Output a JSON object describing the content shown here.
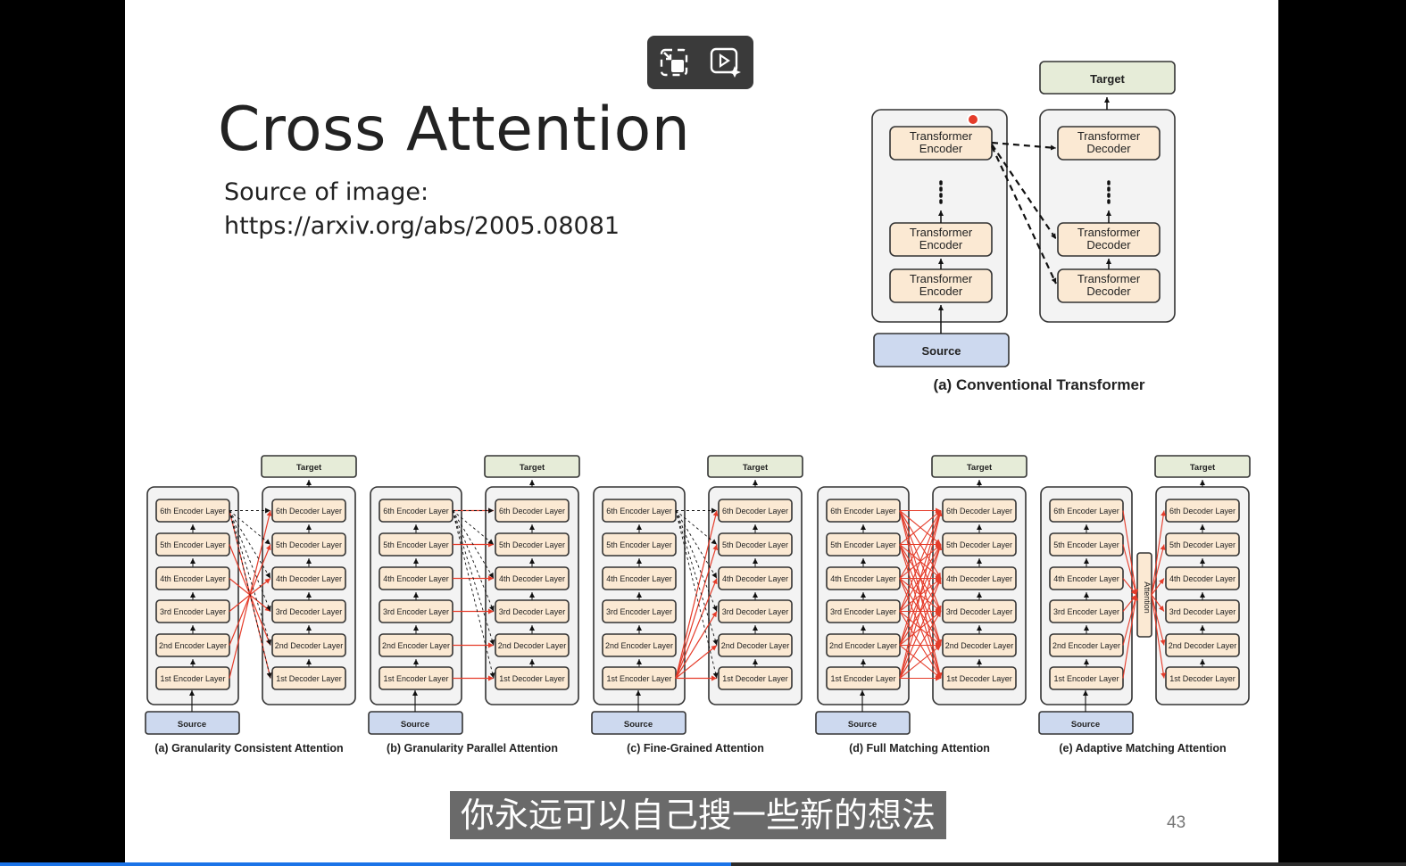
{
  "slide": {
    "title": "Cross Attention",
    "source_label": "Source of image:",
    "source_url": "https://arxiv.org/abs/2005.08081",
    "page_number": "43"
  },
  "subtitle": "你永远可以自己搜一些新的想法",
  "player": {
    "controls": [
      {
        "icon": "exit-fullscreen-icon"
      },
      {
        "icon": "video-ai-icon"
      }
    ],
    "progress": 0.52,
    "progress_color": "#1a73e8"
  },
  "figure_a": {
    "caption": "(a) Conventional Transformer",
    "target": "Target",
    "source": "Source",
    "encoders": [
      "Transformer\nEncoder",
      "Transformer\nEncoder",
      "Transformer\nEncoder"
    ],
    "decoders": [
      "Transformer\nDecoder",
      "Transformer\nDecoder",
      "Transformer\nDecoder"
    ]
  },
  "panels": [
    {
      "caption": "(a) Granularity Consistent Attention",
      "type": "consistent"
    },
    {
      "caption": "(b) Granularity Parallel Attention",
      "type": "parallel"
    },
    {
      "caption": "(c) Fine-Grained Attention",
      "type": "fine"
    },
    {
      "caption": "(d) Full Matching Attention",
      "type": "full"
    },
    {
      "caption": "(e) Adaptive Matching Attention",
      "type": "adaptive"
    }
  ],
  "panel_labels": {
    "target": "Target",
    "source": "Source",
    "attention": "Attention",
    "encoder_layers": [
      "6th Encoder Layer",
      "5th Encoder Layer",
      "4th Encoder Layer",
      "3rd Encoder Layer",
      "2nd Encoder Layer",
      "1st Encoder Layer"
    ],
    "decoder_layers": [
      "6th Decoder Layer",
      "5th Decoder Layer",
      "4th Decoder Layer",
      "3rd Decoder Layer",
      "2nd Decoder Layer",
      "1st Decoder Layer"
    ]
  },
  "colors": {
    "box_fill": "#fbe9d3",
    "source_fill": "#cdd9ef",
    "target_fill": "#e6ecd8",
    "container_fill": "#f3f3f3",
    "arrow_red": "#e53c2a"
  }
}
